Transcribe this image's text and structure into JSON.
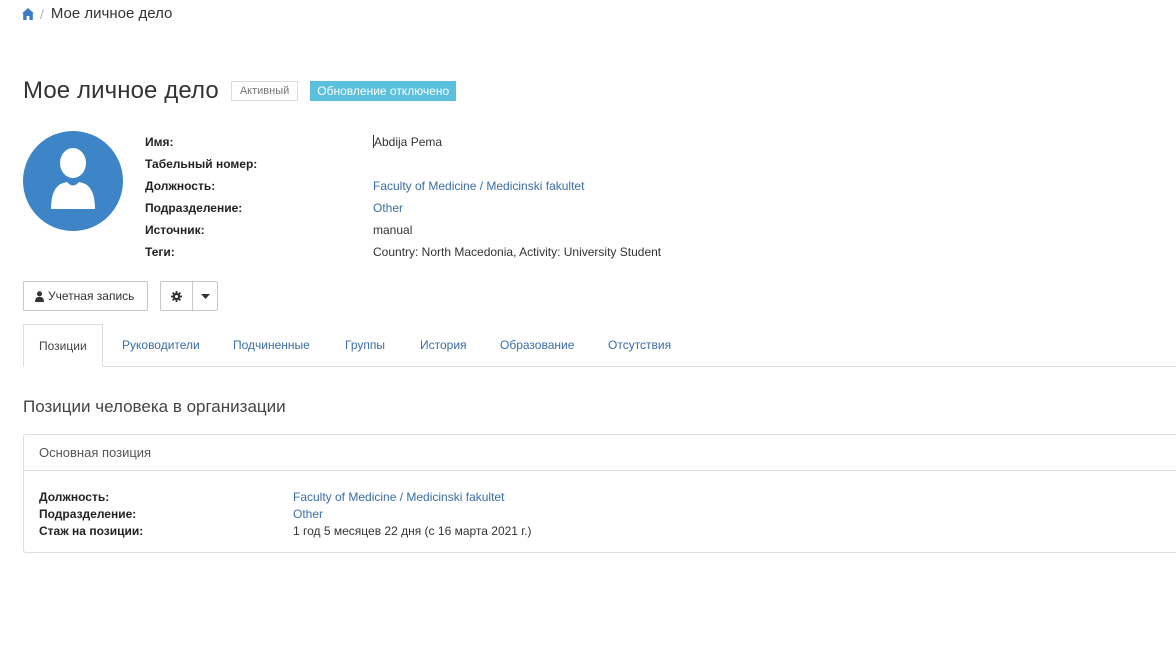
{
  "breadcrumb": {
    "home_icon": "home-icon",
    "separator": "/",
    "current": "Мое личное дело"
  },
  "header": {
    "title": "Мое личное дело",
    "status_badge": "Активный",
    "update_badge": "Обновление отключено",
    "update_badge_color": "#5bc0de"
  },
  "avatar": {
    "icon": "user-silhouette-icon",
    "background": "#3d85c6"
  },
  "details": [
    {
      "label": "Имя:",
      "value": "Abdija Pema",
      "link": false
    },
    {
      "label": "Табельный номер:",
      "value": "",
      "link": false
    },
    {
      "label": "Должность:",
      "value": "Faculty of Medicine / Medicinski fakultet",
      "link": true
    },
    {
      "label": "Подразделение:",
      "value": "Other",
      "link": true
    },
    {
      "label": "Источник:",
      "value": "manual",
      "link": false
    },
    {
      "label": "Теги:",
      "value": "Country: North Macedonia, Activity: University Student",
      "link": false
    }
  ],
  "actions": {
    "account_label": "Учетная запись",
    "account_icon": "user-icon",
    "settings_icon": "gear-icon",
    "caret_icon": "caret-down-icon"
  },
  "tabs": [
    {
      "label": "Позиции",
      "active": true
    },
    {
      "label": "Руководители",
      "active": false
    },
    {
      "label": "Подчиненные",
      "active": false
    },
    {
      "label": "Группы",
      "active": false
    },
    {
      "label": "История",
      "active": false
    },
    {
      "label": "Образование",
      "active": false
    },
    {
      "label": "Отсутствия",
      "active": false
    }
  ],
  "positions": {
    "section_title": "Позиции человека в организации",
    "panel_title": "Основная позиция",
    "rows": [
      {
        "label": "Должность:",
        "value": "Faculty of Medicine / Medicinski fakultet",
        "link": true
      },
      {
        "label": "Подразделение:",
        "value": "Other",
        "link": true
      },
      {
        "label": "Стаж на позиции:",
        "value": "1 год 5 месяцев 22 дня (с 16 марта 2021 г.)",
        "link": false
      }
    ]
  },
  "colors": {
    "link": "#3a6ea8",
    "accent": "#3d85c6"
  }
}
